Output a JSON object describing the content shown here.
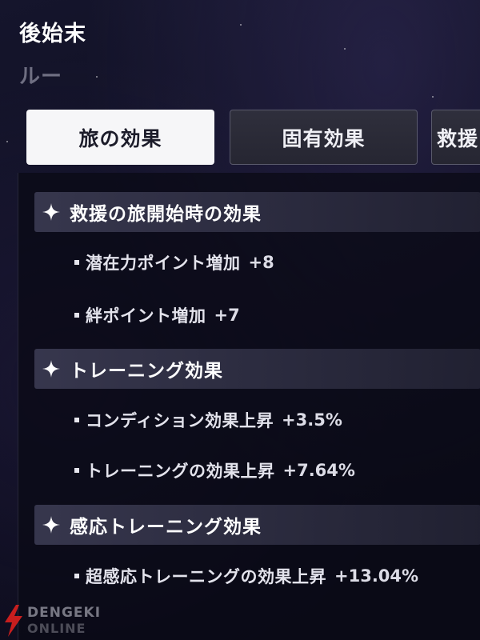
{
  "header": {
    "title": "後始末",
    "subtitle": "ルー"
  },
  "tabs": [
    {
      "label": "旅の効果",
      "active": true
    },
    {
      "label": "固有効果",
      "active": false
    },
    {
      "label": "救援",
      "active": false
    }
  ],
  "sections": [
    {
      "title": "救援の旅開始時の効果",
      "items": [
        {
          "label": "潜在力ポイント増加",
          "value": "+8"
        },
        {
          "label": "絆ポイント増加",
          "value": "+7"
        }
      ]
    },
    {
      "title": "トレーニング効果",
      "items": [
        {
          "label": "コンディション効果上昇",
          "value": "+3.5%"
        },
        {
          "label": "トレーニングの効果上昇",
          "value": "+7.64%"
        }
      ]
    },
    {
      "title": "感応トレーニング効果",
      "items": [
        {
          "label": "超感応トレーニングの効果上昇",
          "value": "+13.04%"
        }
      ]
    }
  ],
  "watermark": {
    "line1": "DENGEKI",
    "line2": "ONLINE"
  },
  "colors": {
    "background": "#0e0e20",
    "active_tab": "#f6f6f8",
    "section_header": "#3e3e56",
    "watermark_logo": "#c81e1e"
  },
  "icons": {
    "section": "sparkle-icon",
    "item": "bullet-icon",
    "watermark": "lightning-bolt-icon"
  }
}
